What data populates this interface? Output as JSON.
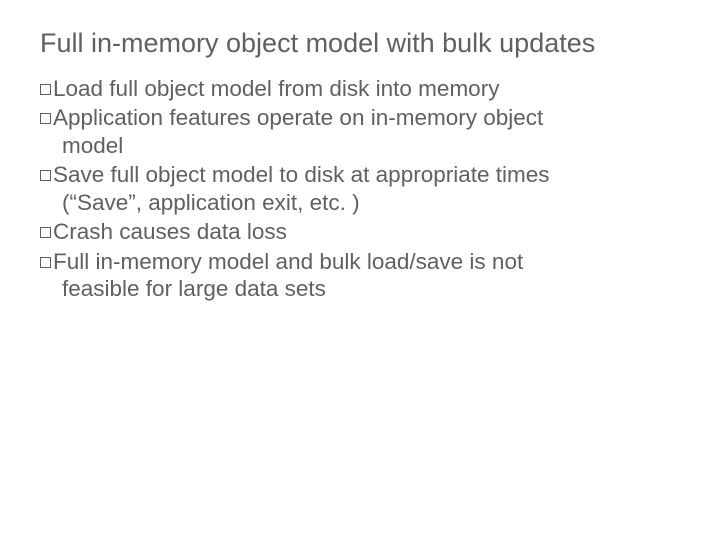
{
  "slide": {
    "title": "Full in-memory object model with bulk updates",
    "bullets": [
      {
        "lines": [
          "Load full object model from disk into memory"
        ]
      },
      {
        "lines": [
          "Application features operate on in-memory object",
          "model"
        ]
      },
      {
        "lines": [
          "Save full object model to disk at appropriate times",
          "(“Save”, application exit, etc. )"
        ]
      },
      {
        "lines": [
          "Crash causes data loss"
        ]
      },
      {
        "lines": [
          "Full in-memory model and bulk load/save is not",
          "feasible for large data sets"
        ]
      }
    ]
  }
}
